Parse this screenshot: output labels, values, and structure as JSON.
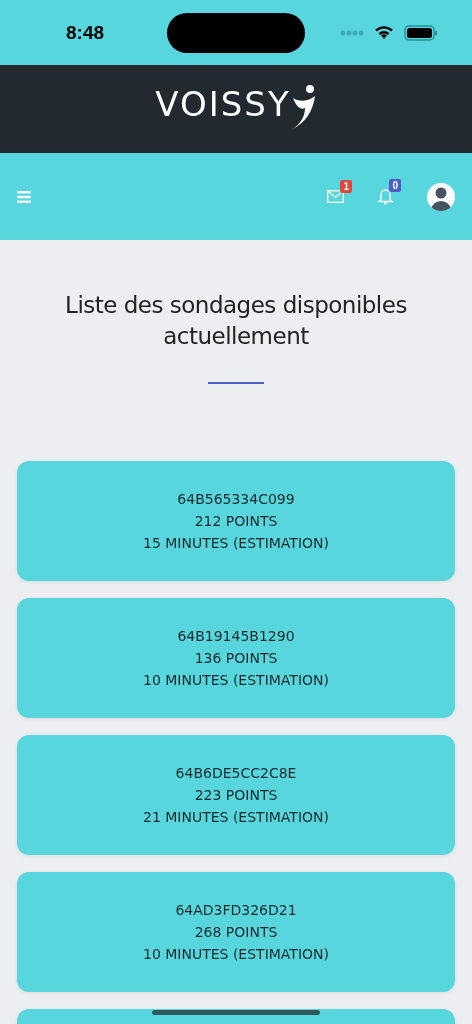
{
  "status_bar": {
    "time": "8:48"
  },
  "brand": {
    "logo": "VOISSY"
  },
  "nav": {
    "messages_badge": "1",
    "notifications_badge": "0"
  },
  "title": "Liste des sondages disponibles actuellement",
  "surveys": [
    {
      "id": "64B565334C099",
      "points": "212 POINTS",
      "duration": "15 MINUTES (ESTIMATION)"
    },
    {
      "id": "64B19145B1290",
      "points": "136 POINTS",
      "duration": "10 MINUTES (ESTIMATION)"
    },
    {
      "id": "64B6DE5CC2C8E",
      "points": "223 POINTS",
      "duration": "21 MINUTES (ESTIMATION)"
    },
    {
      "id": "64AD3FD326D21",
      "points": "268 POINTS",
      "duration": "10 MINUTES (ESTIMATION)"
    }
  ],
  "more_below": true
}
